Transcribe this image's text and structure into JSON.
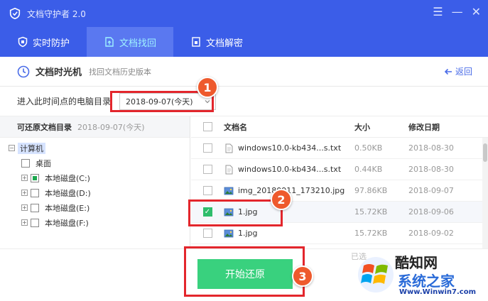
{
  "window": {
    "title": "文档守护者 2.0",
    "controls": [
      "☰",
      "—",
      "✕"
    ]
  },
  "tabs": [
    {
      "label": "实时防护",
      "icon": "shield-icon",
      "active": false
    },
    {
      "label": "文档找回",
      "icon": "document-restore-icon",
      "active": true
    },
    {
      "label": "文档解密",
      "icon": "document-decrypt-icon",
      "active": false
    }
  ],
  "subheader": {
    "title": "文档时光机",
    "desc": "找回文档历史版本",
    "back_label": "返回"
  },
  "date_row": {
    "label": "进入此时间点的电脑目录",
    "selected_date": "2018-09-07(今天)"
  },
  "tree": {
    "header_title": "可还原文档目录",
    "header_date": "2018-09-07(今天)",
    "root": "计算机",
    "desktop": "桌面",
    "drives": [
      "本地磁盘(C:)",
      "本地磁盘(D:)",
      "本地磁盘(E:)",
      "本地磁盘(F:)"
    ]
  },
  "table": {
    "headers": {
      "name": "文档名",
      "size": "大小",
      "date": "修改日期"
    },
    "rows": [
      {
        "name": "windows10.0-kb434...s.txt",
        "size": "0.50KB",
        "date": "2018-08-30",
        "icon": "text-file-icon",
        "checked": false
      },
      {
        "name": "windows10.0-kb434...s.txt",
        "size": "0.44KB",
        "date": "2018-08-30",
        "icon": "text-file-icon",
        "checked": false
      },
      {
        "name": "img_20180911_173210.jpg",
        "size": "97.86KB",
        "date": "2018-09-07",
        "icon": "image-file-icon",
        "checked": false
      },
      {
        "name": "1.jpg",
        "size": "15.72KB",
        "date": "2018-09-06",
        "icon": "image-file-icon",
        "checked": true
      },
      {
        "name": "1.jpg",
        "size": "15.72KB",
        "date": "2018-09-02",
        "icon": "image-file-icon",
        "checked": false
      }
    ]
  },
  "footer": {
    "restore_label": "开始还原",
    "status_text": "已选"
  },
  "annotations": [
    "1",
    "2",
    "3"
  ],
  "watermark": {
    "title": "酷知网",
    "subtitle": "系统之家",
    "url": "Www.Winwin7.com"
  },
  "colors": {
    "primary": "#3b5de8",
    "tab_active_text": "#9ff3ff",
    "restore_button": "#39d17e",
    "checkbox_checked": "#2ebd6b",
    "annotation_red": "#e3262c",
    "marker_orange": "#ee5a2d"
  }
}
